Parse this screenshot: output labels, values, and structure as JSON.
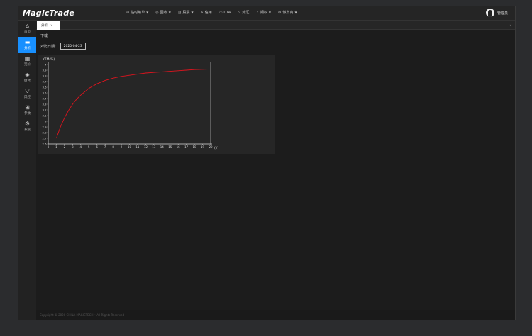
{
  "app": {
    "logo": "MagicTrade"
  },
  "nav": {
    "items": [
      {
        "label": "临时菜单",
        "icon": "circle-icon",
        "dropdown": true
      },
      {
        "label": "固收",
        "icon": "target-icon",
        "dropdown": true
      },
      {
        "label": "股票",
        "icon": "chart-icon",
        "dropdown": true
      },
      {
        "label": "信用",
        "icon": "edit-icon",
        "dropdown": false
      },
      {
        "label": "CTA",
        "icon": "folder-icon",
        "dropdown": false
      },
      {
        "label": "外汇",
        "icon": "currency-icon",
        "dropdown": false
      },
      {
        "label": "期权",
        "icon": "trend-icon",
        "dropdown": true
      },
      {
        "label": "做市商",
        "icon": "gear-icon",
        "dropdown": true
      }
    ]
  },
  "user": {
    "name": "管理员"
  },
  "tabs": [
    {
      "label": "分析"
    }
  ],
  "sidebar": {
    "items": [
      {
        "label": "首页",
        "icon": "home-icon",
        "active": false
      },
      {
        "label": "分析",
        "icon": "chat-icon",
        "active": true
      },
      {
        "label": "定价",
        "icon": "calendar-icon",
        "active": false
      },
      {
        "label": "组合",
        "icon": "cube-icon",
        "active": false
      },
      {
        "label": "风控",
        "icon": "shield-icon",
        "active": false
      },
      {
        "label": "参数",
        "icon": "grid-icon",
        "active": false
      },
      {
        "label": "系统",
        "icon": "gear-icon",
        "active": false
      }
    ]
  },
  "main": {
    "section_label": "下载",
    "date_label": "对比日期:",
    "date_value": "2020-04-23"
  },
  "footer": {
    "text": "Copyright © 2020 CHINA MAGICTECH • All Rights Reserved"
  },
  "chart_data": {
    "type": "line",
    "title": "",
    "ylabel": "YTM(%)",
    "xlabel": "(Y)",
    "xlim": [
      0,
      20
    ],
    "ylim": [
      2.6,
      4.0
    ],
    "x_ticks": [
      "0",
      "1",
      "2",
      "3",
      "4",
      "5",
      "6",
      "7",
      "8",
      "9",
      "10",
      "11",
      "12",
      "13",
      "14",
      "15",
      "16",
      "17",
      "18",
      "19",
      "20"
    ],
    "y_ticks": [
      "2.6",
      "2.7",
      "2.8",
      "2.9",
      "3",
      "3.1",
      "3.2",
      "3.3",
      "3.4",
      "3.5",
      "3.6",
      "3.7",
      "3.8",
      "3.9",
      "4"
    ],
    "series": [
      {
        "color": "#e0141e",
        "x": [
          1,
          1.5,
          2,
          2.5,
          3,
          3.5,
          4,
          5,
          6,
          7,
          8,
          9,
          10,
          11,
          12,
          13,
          14,
          15,
          16,
          17,
          18,
          19,
          20
        ],
        "y": [
          2.7,
          2.9,
          3.06,
          3.19,
          3.3,
          3.39,
          3.46,
          3.58,
          3.66,
          3.72,
          3.76,
          3.79,
          3.81,
          3.83,
          3.85,
          3.86,
          3.87,
          3.88,
          3.89,
          3.9,
          3.91,
          3.915,
          3.92
        ]
      }
    ]
  }
}
